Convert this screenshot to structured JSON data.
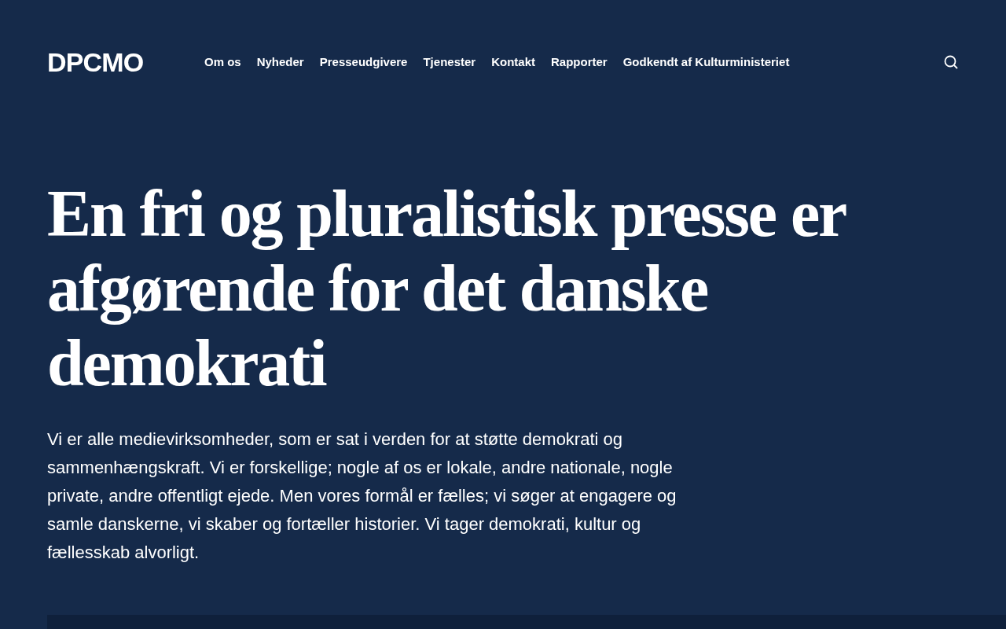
{
  "header": {
    "logo": "DPCMO",
    "nav": [
      "Om os",
      "Nyheder",
      "Presseudgivere",
      "Tjenester",
      "Kontakt",
      "Rapporter",
      "Godkendt af Kulturministeriet"
    ]
  },
  "hero": {
    "title": "En fri og pluralistisk presse er afgørende for det danske demokrati",
    "text": "Vi er alle medievirksomheder, som er sat i verden for at støtte demokrati og sammenhængskraft. Vi er forskellige; nogle af os er lokale, andre nationale, nogle private, andre offentligt ejede. Men vores formål er fælles; vi søger at engagere og samle danskerne, vi skaber og fortæller historier. Vi tager demokrati, kultur og fællesskab alvorligt."
  }
}
